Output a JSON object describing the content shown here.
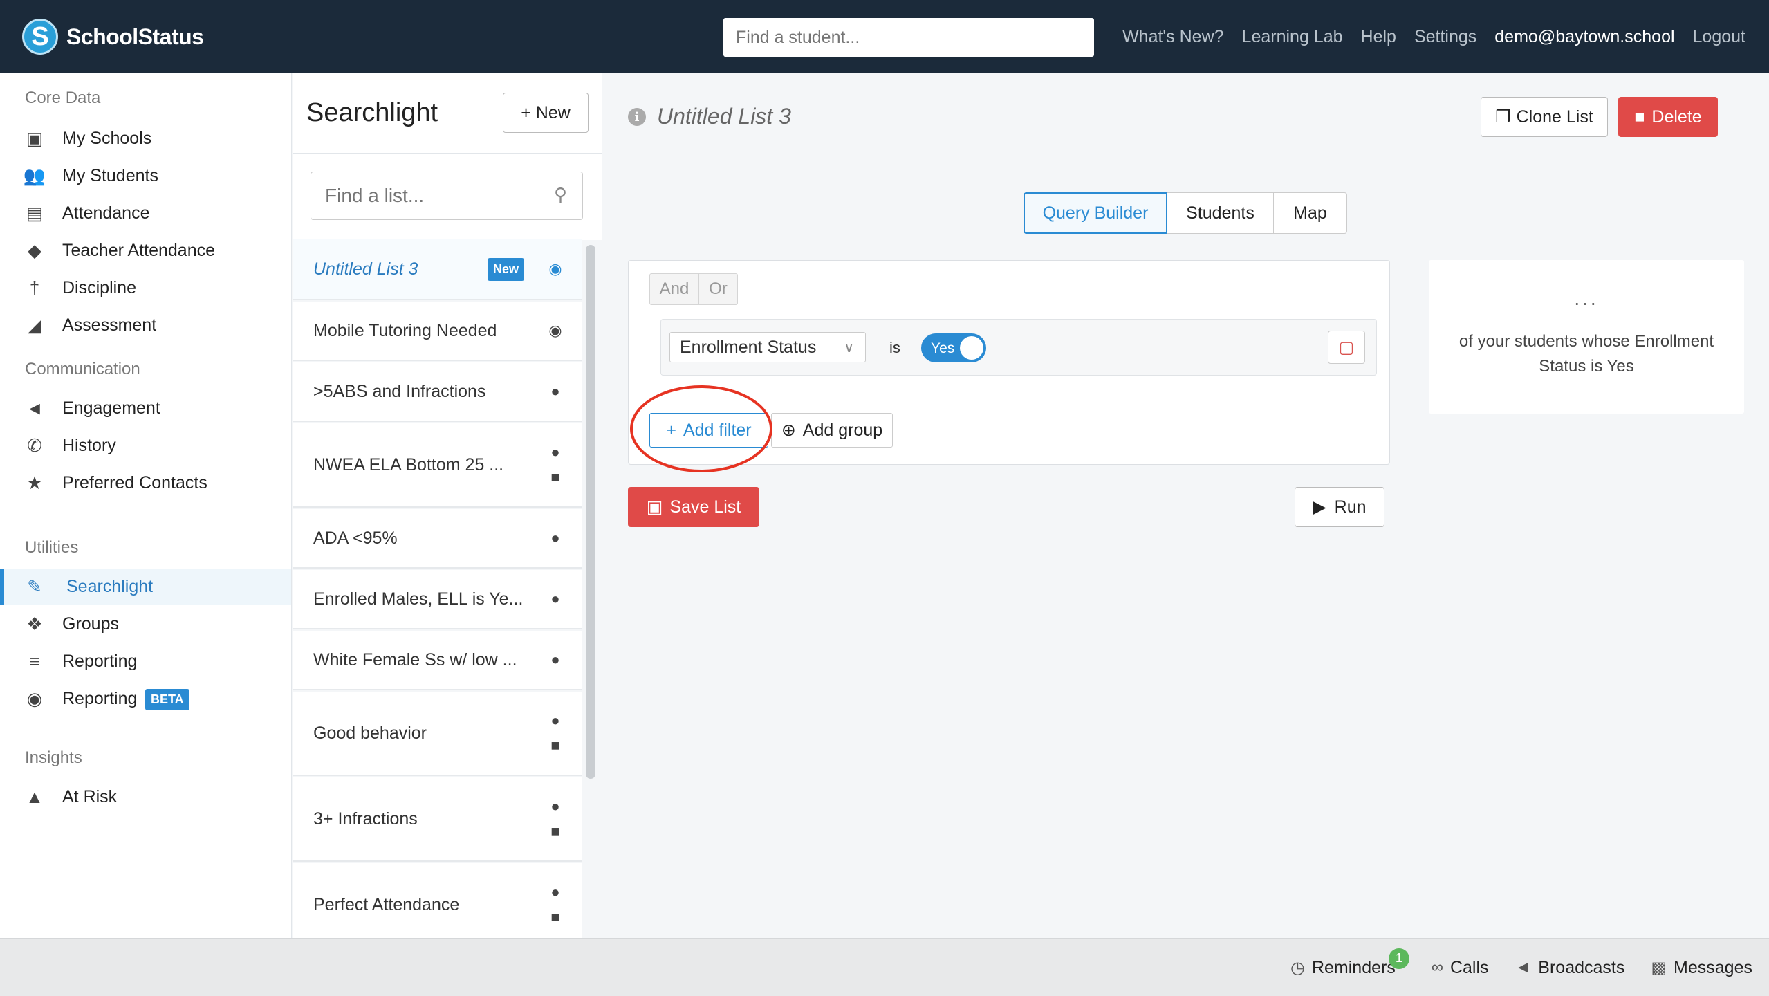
{
  "app": {
    "brand": "SchoolStatus"
  },
  "topbar": {
    "search_placeholder": "Find a student...",
    "links": [
      "What's New?",
      "Learning Lab",
      "Help",
      "Settings"
    ],
    "user": "demo@baytown.school",
    "logout": "Logout"
  },
  "sidebar": {
    "sections": [
      {
        "title": "Core Data",
        "items": [
          {
            "label": "My Schools",
            "icon": "school-icon"
          },
          {
            "label": "My Students",
            "icon": "students-icon"
          },
          {
            "label": "Attendance",
            "icon": "calendar-icon"
          },
          {
            "label": "Teacher Attendance",
            "icon": "ticket-icon"
          },
          {
            "label": "Discipline",
            "icon": "thermometer-icon"
          },
          {
            "label": "Assessment",
            "icon": "area-chart-icon"
          }
        ]
      },
      {
        "title": "Communication",
        "items": [
          {
            "label": "Engagement",
            "icon": "megaphone-icon"
          },
          {
            "label": "History",
            "icon": "phone-icon"
          },
          {
            "label": "Preferred Contacts",
            "icon": "star-icon"
          }
        ]
      },
      {
        "title": "Utilities",
        "items": [
          {
            "label": "Searchlight",
            "icon": "flashlight-icon"
          },
          {
            "label": "Groups",
            "icon": "groups-icon"
          },
          {
            "label": "Reporting",
            "icon": "report-icon"
          },
          {
            "label": "Reporting",
            "icon": "record-icon",
            "badge": "BETA"
          }
        ]
      },
      {
        "title": "Insights",
        "items": [
          {
            "label": "At Risk",
            "icon": "cone-icon"
          }
        ]
      }
    ]
  },
  "searchlight": {
    "title": "Searchlight",
    "new_button": "New",
    "search_placeholder": "Find a list...",
    "lists": [
      {
        "name": "Untitled List 3",
        "badge": "New",
        "icons": [
          "hidden-icon"
        ]
      },
      {
        "name": "Mobile Tutoring Needed",
        "icons": [
          "hidden-icon"
        ]
      },
      {
        "name": ">5ABS and Infractions",
        "icons": [
          "globe-icon"
        ]
      },
      {
        "name": "NWEA ELA Bottom 25 ...",
        "icons": [
          "globe-icon",
          "lock-icon"
        ]
      },
      {
        "name": "ADA <95%",
        "icons": [
          "globe-icon"
        ]
      },
      {
        "name": "Enrolled Males, ELL is Ye...",
        "icons": [
          "globe-icon"
        ]
      },
      {
        "name": "White Female Ss w/ low ...",
        "icons": [
          "globe-icon"
        ]
      },
      {
        "name": "Good behavior",
        "icons": [
          "globe-icon",
          "lock-icon"
        ]
      },
      {
        "name": "3+ Infractions",
        "icons": [
          "globe-icon",
          "lock-icon"
        ]
      },
      {
        "name": "Perfect Attendance",
        "icons": [
          "globe-icon",
          "lock-icon"
        ]
      }
    ]
  },
  "main": {
    "list_name": "Untitled List 3",
    "clone_button": "Clone List",
    "delete_button": "Delete",
    "tabs": [
      "Query Builder",
      "Students",
      "Map"
    ],
    "active_tab": "Query Builder",
    "query": {
      "and_label": "And",
      "or_label": "Or",
      "rule": {
        "field": "Enrollment Status",
        "operator": "is",
        "value": "Yes"
      },
      "add_filter": "Add filter",
      "add_group": "Add group"
    },
    "save_button": "Save List",
    "run_button": "Run",
    "result": {
      "count": "...",
      "description": "of your students whose Enrollment Status is Yes"
    }
  },
  "bottombar": {
    "reminders": "Reminders",
    "reminders_count": "1",
    "calls": "Calls",
    "broadcasts": "Broadcasts",
    "messages": "Messages"
  },
  "colors": {
    "topbar_bg": "#1b2a3a",
    "accent": "#2a8bd3",
    "danger": "#e04a48",
    "highlight_ring": "#e63322"
  }
}
